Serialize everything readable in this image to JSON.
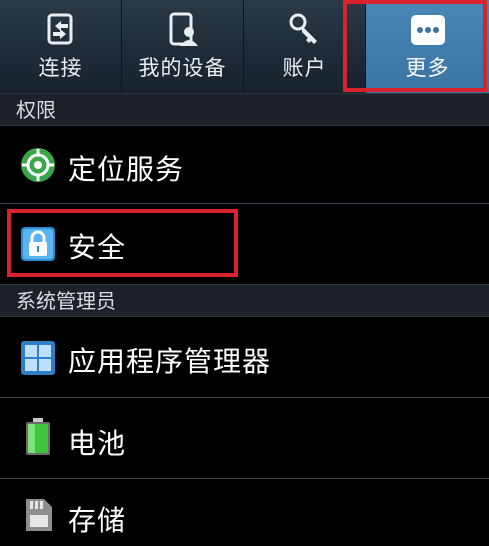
{
  "tabs": [
    {
      "label": "连接",
      "icon": "connections-icon"
    },
    {
      "label": "我的设备",
      "icon": "my-device-icon"
    },
    {
      "label": "账户",
      "icon": "accounts-key-icon"
    },
    {
      "label": "更多",
      "icon": "more-dots-icon",
      "active": true
    }
  ],
  "sections": {
    "permissions": "权限",
    "system_admin": "系统管理员"
  },
  "items": {
    "location": "定位服务",
    "security": "安全",
    "app_manager": "应用程序管理器",
    "battery": "电池",
    "storage": "存储"
  },
  "colors": {
    "active_tab": "#4a86b7",
    "highlight": "#d8232f",
    "location_green": "#3aa64a",
    "security_blue": "#2a8fd6"
  }
}
